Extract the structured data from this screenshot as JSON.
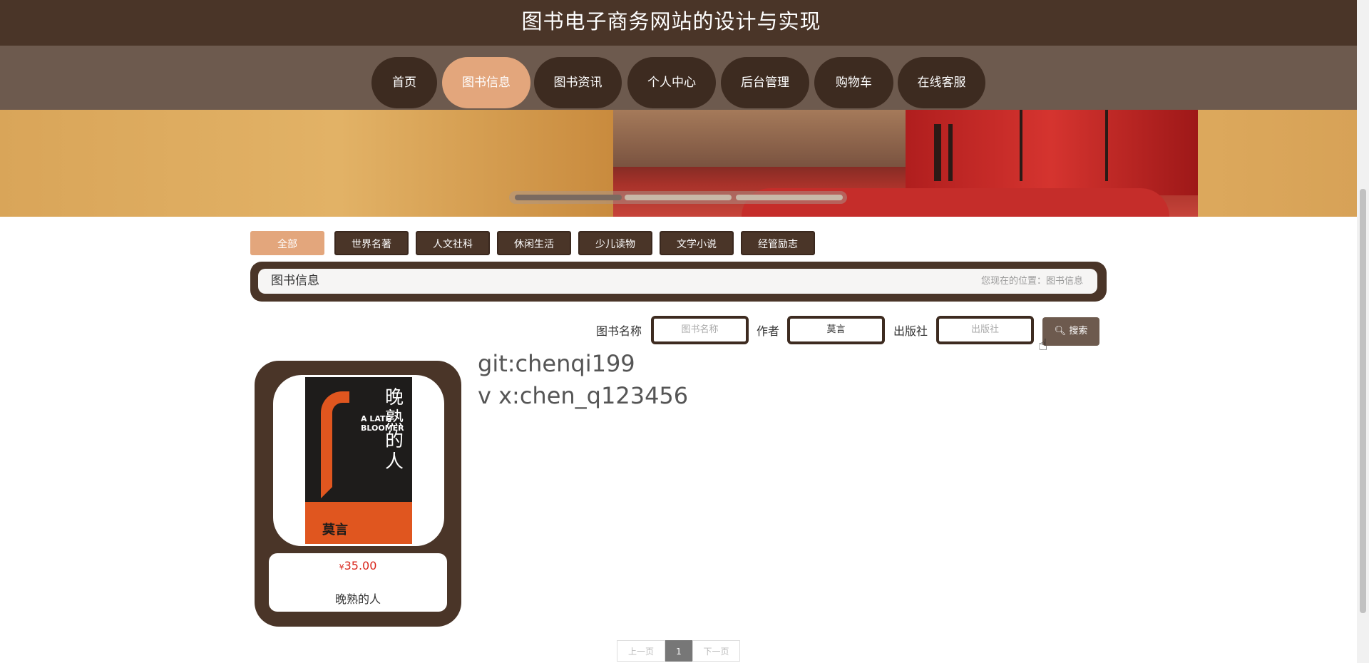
{
  "site": {
    "title": "图书电子商务网站的设计与实现"
  },
  "nav": {
    "items": [
      {
        "label": "首页"
      },
      {
        "label": "图书信息"
      },
      {
        "label": "图书资讯"
      },
      {
        "label": "个人中心"
      },
      {
        "label": "后台管理"
      },
      {
        "label": "购物车"
      },
      {
        "label": "在线客服"
      }
    ],
    "active_index": 1
  },
  "banner": {
    "cover_text_cn": "晚熟的人",
    "cover_text_en": "A LATE BLOOMER",
    "cover_author": "莫言"
  },
  "categories": {
    "items": [
      {
        "label": "全部"
      },
      {
        "label": "世界名著"
      },
      {
        "label": "人文社科"
      },
      {
        "label": "休闲生活"
      },
      {
        "label": "少儿读物"
      },
      {
        "label": "文学小说"
      },
      {
        "label": "经管励志"
      }
    ],
    "active_index": 0
  },
  "breadcrumb": {
    "title": "图书信息",
    "location": "您现在的位置：图书信息"
  },
  "search": {
    "name_label": "图书名称",
    "name_placeholder": "图书名称",
    "name_value": "",
    "author_label": "作者",
    "author_value": "莫言",
    "publisher_label": "出版社",
    "publisher_placeholder": "出版社",
    "publisher_value": "",
    "button_label": "搜索"
  },
  "watermark": {
    "line1": "git:chenqi199",
    "line2": "v x:chen_q123456"
  },
  "products": [
    {
      "currency": "¥",
      "price": "35.00",
      "name": "晚熟的人"
    }
  ],
  "pagination": {
    "prev_label": "上一页",
    "current_page": "1",
    "next_label": "下一页"
  },
  "colors": {
    "brand_dark": "#4a3528",
    "nav_bg": "#6d5a4e",
    "accent": "#e3a67c",
    "price": "#d9261c"
  }
}
